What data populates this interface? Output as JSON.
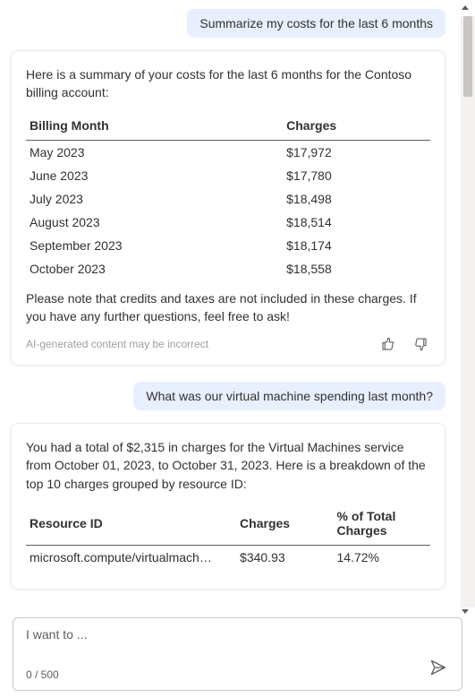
{
  "messages": {
    "user1": "Summarize my costs for the last 6 months",
    "ai1": {
      "intro": "Here is a summary of your costs for the last 6 months for the Contoso billing account:",
      "table_header_month": "Billing Month",
      "table_header_charges": "Charges",
      "rows": [
        {
          "month": "May 2023",
          "charges": "$17,972"
        },
        {
          "month": "June 2023",
          "charges": "$17,780"
        },
        {
          "month": "July 2023",
          "charges": "$18,498"
        },
        {
          "month": "August 2023",
          "charges": "$18,514"
        },
        {
          "month": "September 2023",
          "charges": "$18,174"
        },
        {
          "month": "October 2023",
          "charges": "$18,558"
        }
      ],
      "note": "Please note that credits and taxes are not included in these charges. If you have any further questions, feel free to ask!",
      "disclaimer": "AI-generated content may be incorrect"
    },
    "user2": "What was our virtual machine spending last month?",
    "ai2": {
      "intro": "You had a total of $2,315 in charges for the Virtual Machines service from October 01, 2023, to October 31, 2023. Here is a breakdown of the top 10 charges grouped by resource ID:",
      "table_header_resource": "Resource ID",
      "table_header_charges": "Charges",
      "table_header_pct": "% of Total Charges",
      "rows": [
        {
          "resource": "microsoft.compute/virtualmach…",
          "charges": "$340.93",
          "pct": "14.72%"
        }
      ]
    }
  },
  "input": {
    "placeholder": "I want to ...",
    "counter": "0 / 500"
  }
}
